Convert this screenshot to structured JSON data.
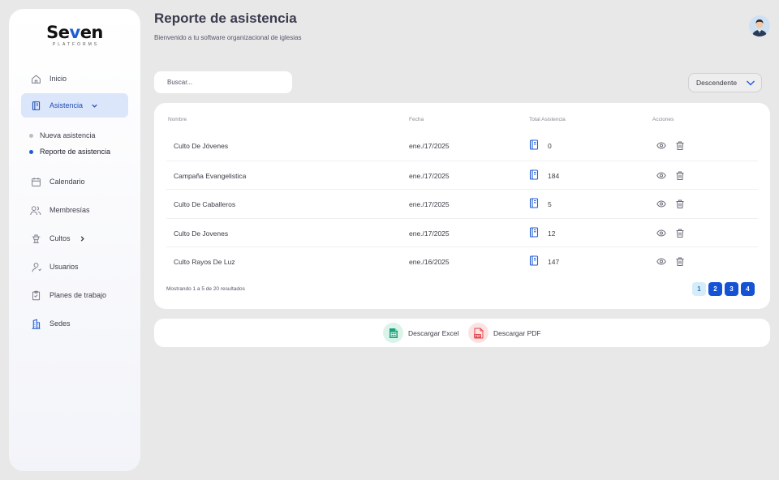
{
  "brand": {
    "name_prefix": "Se",
    "name_v": "v",
    "name_suffix": "en",
    "tagline": "PLATFORMS"
  },
  "sidebar": {
    "items": [
      {
        "label": "Inicio",
        "icon": "home-icon"
      },
      {
        "label": "Asistencia",
        "icon": "book-icon",
        "active": true,
        "expanded": true
      },
      {
        "label": "Calendario",
        "icon": "calendar-icon"
      },
      {
        "label": "Membresías",
        "icon": "users-icon"
      },
      {
        "label": "Cultos",
        "icon": "podium-icon",
        "has_submenu": true
      },
      {
        "label": "Usuarios",
        "icon": "user-icon"
      },
      {
        "label": "Planes de trabajo",
        "icon": "clipboard-icon"
      },
      {
        "label": "Sedes",
        "icon": "building-icon"
      }
    ],
    "subitems": [
      {
        "label": "Nueva asistencia"
      },
      {
        "label": "Reporte de asistencia",
        "current": true
      }
    ]
  },
  "header": {
    "title": "Reporte de asistencia",
    "subtitle": "Bienvenido a tu software organizacional de iglesias"
  },
  "search": {
    "placeholder": "Buscar...",
    "value": ""
  },
  "sort": {
    "selected": "Descendente"
  },
  "table": {
    "columns": [
      "Nombre",
      "Fecha",
      "Total Asistencia",
      "Acciones"
    ],
    "rows": [
      {
        "name": "Culto De Jóvenes",
        "date": "ene./17/2025",
        "total": "0"
      },
      {
        "name": "Campaña Evangelistica",
        "date": "ene./17/2025",
        "total": "184"
      },
      {
        "name": "Culto De Caballeros",
        "date": "ene./17/2025",
        "total": "5"
      },
      {
        "name": "Culto De Jovenes",
        "date": "ene./17/2025",
        "total": "12"
      },
      {
        "name": "Culto Rayos De Luz",
        "date": "ene./16/2025",
        "total": "147"
      }
    ],
    "summary": "Mostrando 1 a 5 de 20 resultados",
    "pages": [
      "1",
      "2",
      "3",
      "4"
    ],
    "current_page": "1"
  },
  "downloads": {
    "excel_label": "Descargar Excel",
    "pdf_label": "Descargar PDF"
  },
  "colors": {
    "accent": "#1e5bd6",
    "active_bg": "#dbe6fb",
    "excel": "#1aa37a",
    "pdf": "#e0474c"
  }
}
